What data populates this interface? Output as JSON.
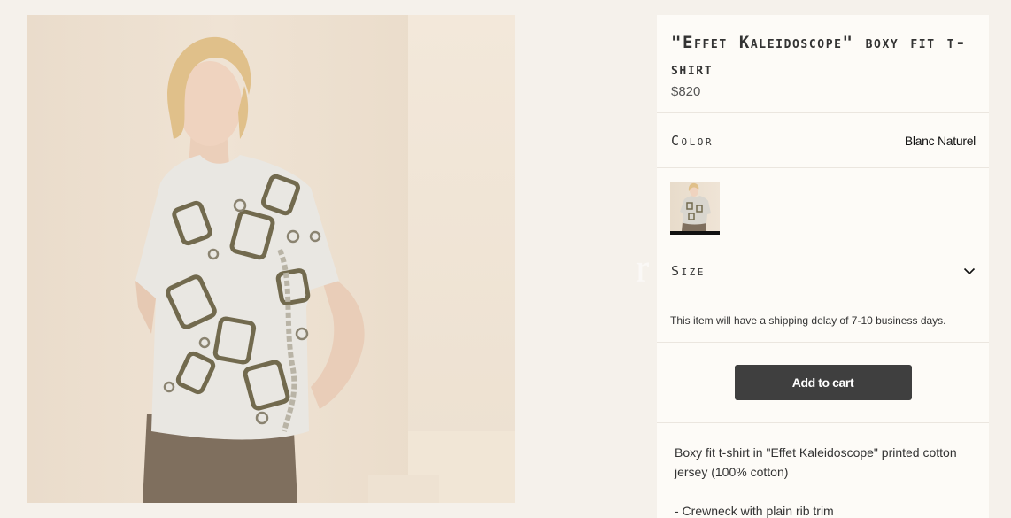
{
  "product": {
    "title": "\"Effet Kaleidoscope\" boxy fit t-shirt",
    "price": "$820",
    "image_icon": "model-wearing-printed-tshirt"
  },
  "color": {
    "label": "Color",
    "value": "Blanc Naturel",
    "swatches": [
      {
        "icon": "tshirt-swatch-thumbnail",
        "selected": true
      }
    ]
  },
  "size": {
    "label": "Size",
    "icon": "chevron-down-icon"
  },
  "shipping": {
    "notice": "This item will have a shipping delay of 7-10 business days."
  },
  "cart": {
    "button_label": "Add to cart"
  },
  "description": {
    "paragraphs": [
      "Boxy fit t-shirt in \"Effet Kaleidoscope\" printed cotton jersey (100% cotton)",
      "- Crewneck with plain rib trim"
    ]
  },
  "colors": {
    "page_bg": "#f5f1eb",
    "panel_bg": "#fdfbf7",
    "button_bg": "#3f3f3f",
    "divider": "#ebe6df"
  }
}
